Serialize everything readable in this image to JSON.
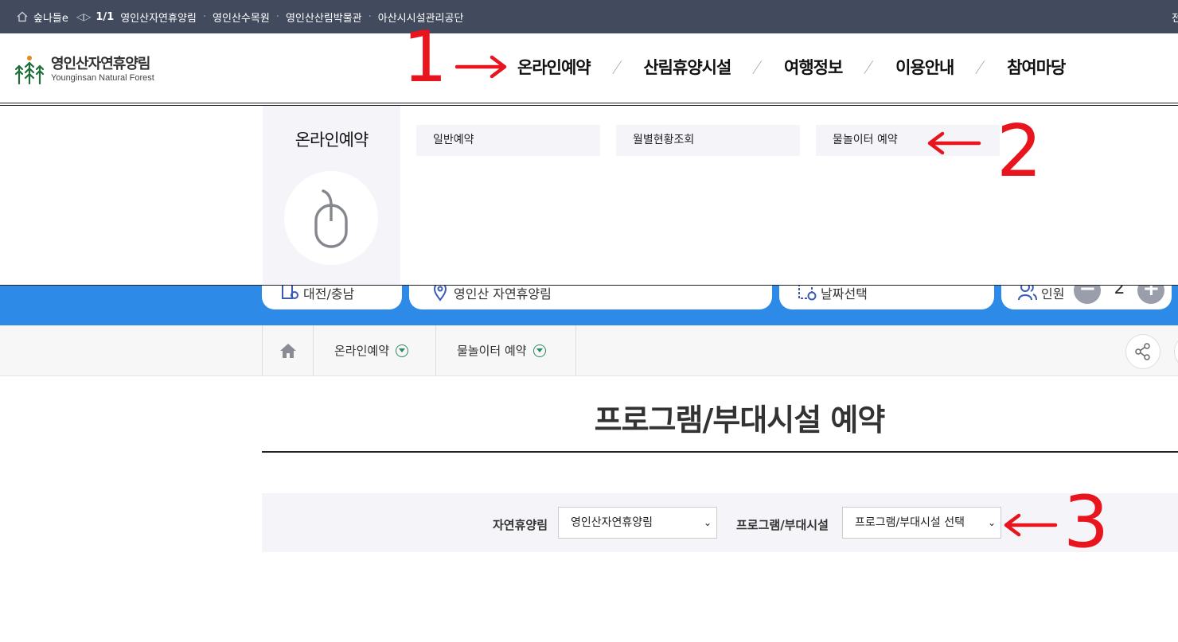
{
  "topbar": {
    "brand": "숲나들e",
    "arrows": "◁▷",
    "count": "1/1",
    "sites": [
      "영인산자연휴양림",
      "영인산수목원",
      "영인산산림박물관",
      "아산시시설관리공단"
    ],
    "right_fragment": "전"
  },
  "logo": {
    "name_kr": "영인산자연휴양림",
    "name_en": "Younginsan Natural Forest"
  },
  "gnb": {
    "items": [
      "온라인예약",
      "산림휴양시설",
      "여행정보",
      "이용안내",
      "참여마당"
    ]
  },
  "mega": {
    "title": "온라인예약",
    "submenu": [
      "일반예약",
      "월별현황조회",
      "물놀이터 예약"
    ]
  },
  "search": {
    "region": "대전/충남",
    "facility": "영인산 자연휴양림",
    "date": "날짜선택",
    "people_label": "인원",
    "people_value": "2",
    "minus": "−",
    "plus": "+"
  },
  "breadcrumb": {
    "items": [
      "온라인예약",
      "물놀이터 예약"
    ]
  },
  "page": {
    "title": "프로그램/부대시설 예약"
  },
  "filter": {
    "forest_label": "자연휴양림",
    "forest_value": "영인산자연휴양림",
    "program_label": "프로그램/부대시설",
    "program_value": "프로그램/부대시설 선택"
  },
  "annotations": [
    "1",
    "2",
    "3"
  ],
  "colors": {
    "topbar": "#424a5e",
    "blueband": "#2d8ae6",
    "annotation": "#e8141e",
    "panel": "#f5f5f9"
  }
}
